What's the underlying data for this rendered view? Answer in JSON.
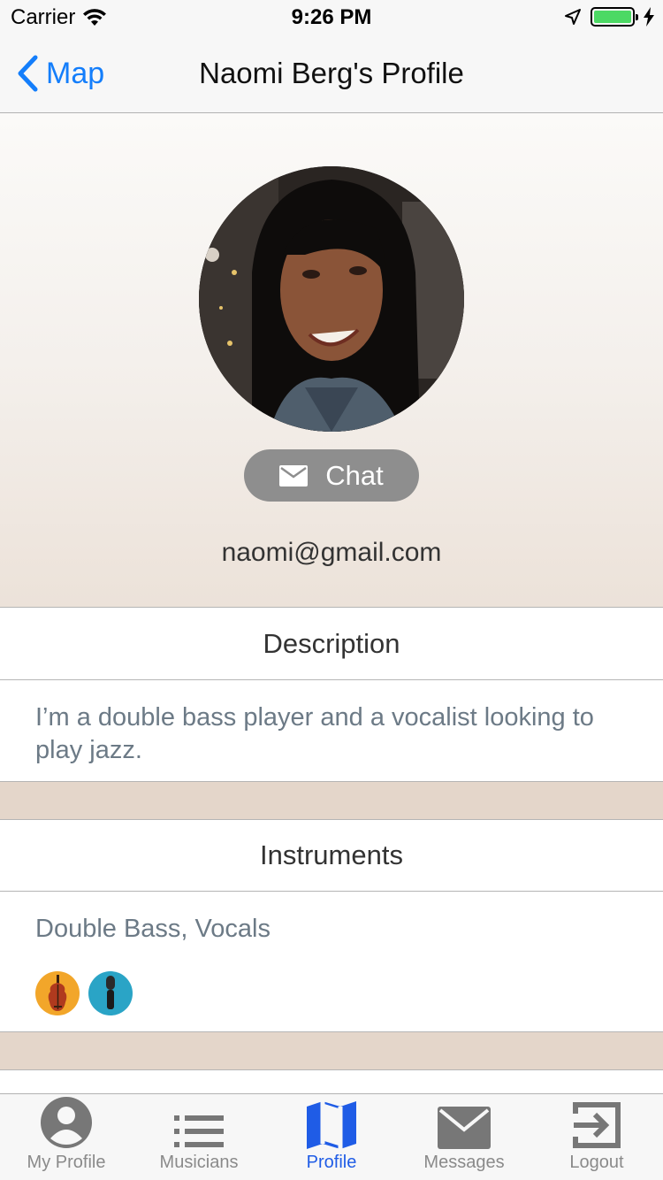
{
  "status_bar": {
    "carrier": "Carrier",
    "time": "9:26 PM",
    "battery_level": 1.0
  },
  "nav": {
    "back_label": "Map",
    "title": "Naomi Berg's Profile"
  },
  "profile": {
    "avatar_icon": "profile-photo",
    "chat_label": "Chat",
    "email": "naomi@gmail.com"
  },
  "description": {
    "header": "Description",
    "text": "I’m a double bass player and a vocalist looking to play jazz."
  },
  "instruments": {
    "header": "Instruments",
    "text": "Double Bass, Vocals",
    "icons": [
      {
        "name": "double-bass-icon",
        "color": "#f2a62a"
      },
      {
        "name": "microphone-icon",
        "color": "#2aa4c6"
      }
    ]
  },
  "tabs": [
    {
      "label": "My Profile",
      "icon": "person-icon"
    },
    {
      "label": "Musicians",
      "icon": "list-icon"
    },
    {
      "label": "Profile",
      "icon": "map-icon",
      "active": true
    },
    {
      "label": "Messages",
      "icon": "envelope-icon"
    },
    {
      "label": "Logout",
      "icon": "logout-icon"
    }
  ],
  "colors": {
    "accent": "#147efb",
    "active_tab": "#1f5ce6",
    "chat_button": "#8e8e8e",
    "spacer": "#e4d6ca"
  }
}
